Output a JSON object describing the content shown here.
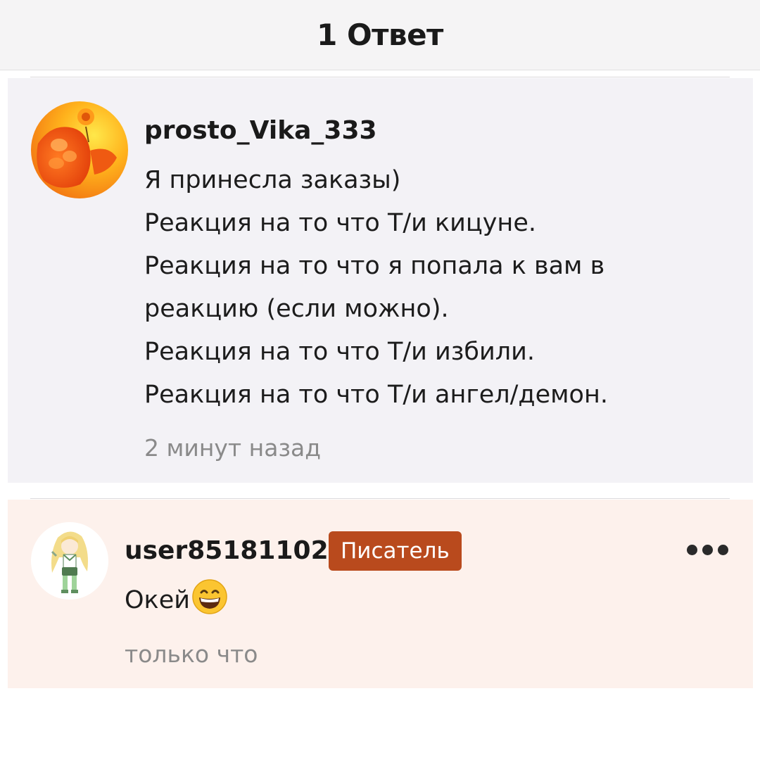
{
  "header": {
    "title": "1 Ответ"
  },
  "parent_comment": {
    "username": "prosto_Vika_333",
    "avatar_icon": "hand-dandelion-photo",
    "lines": [
      "Я принесла заказы)",
      "Реакция на то что Т/и кицуне.",
      "Реакция на то что я попала к вам в",
      "реакцию (если можно).",
      "Реакция на то что Т/и избили.",
      "Реакция на то что Т/и ангел/демон."
    ],
    "timestamp": "2 минут назад"
  },
  "reply": {
    "username": "user85181102",
    "badge": "Писатель",
    "avatar_icon": "anime-character-drawing",
    "text": "Окей",
    "emoji_icon": "grinning-face-emoji",
    "timestamp": "только что",
    "more_icon": "more-dots-icon"
  },
  "colors": {
    "parent_bg": "#f3f2f6",
    "reply_bg": "#fdf1ec",
    "badge_bg": "#b94a1d",
    "timestamp": "#8a8a8a"
  }
}
